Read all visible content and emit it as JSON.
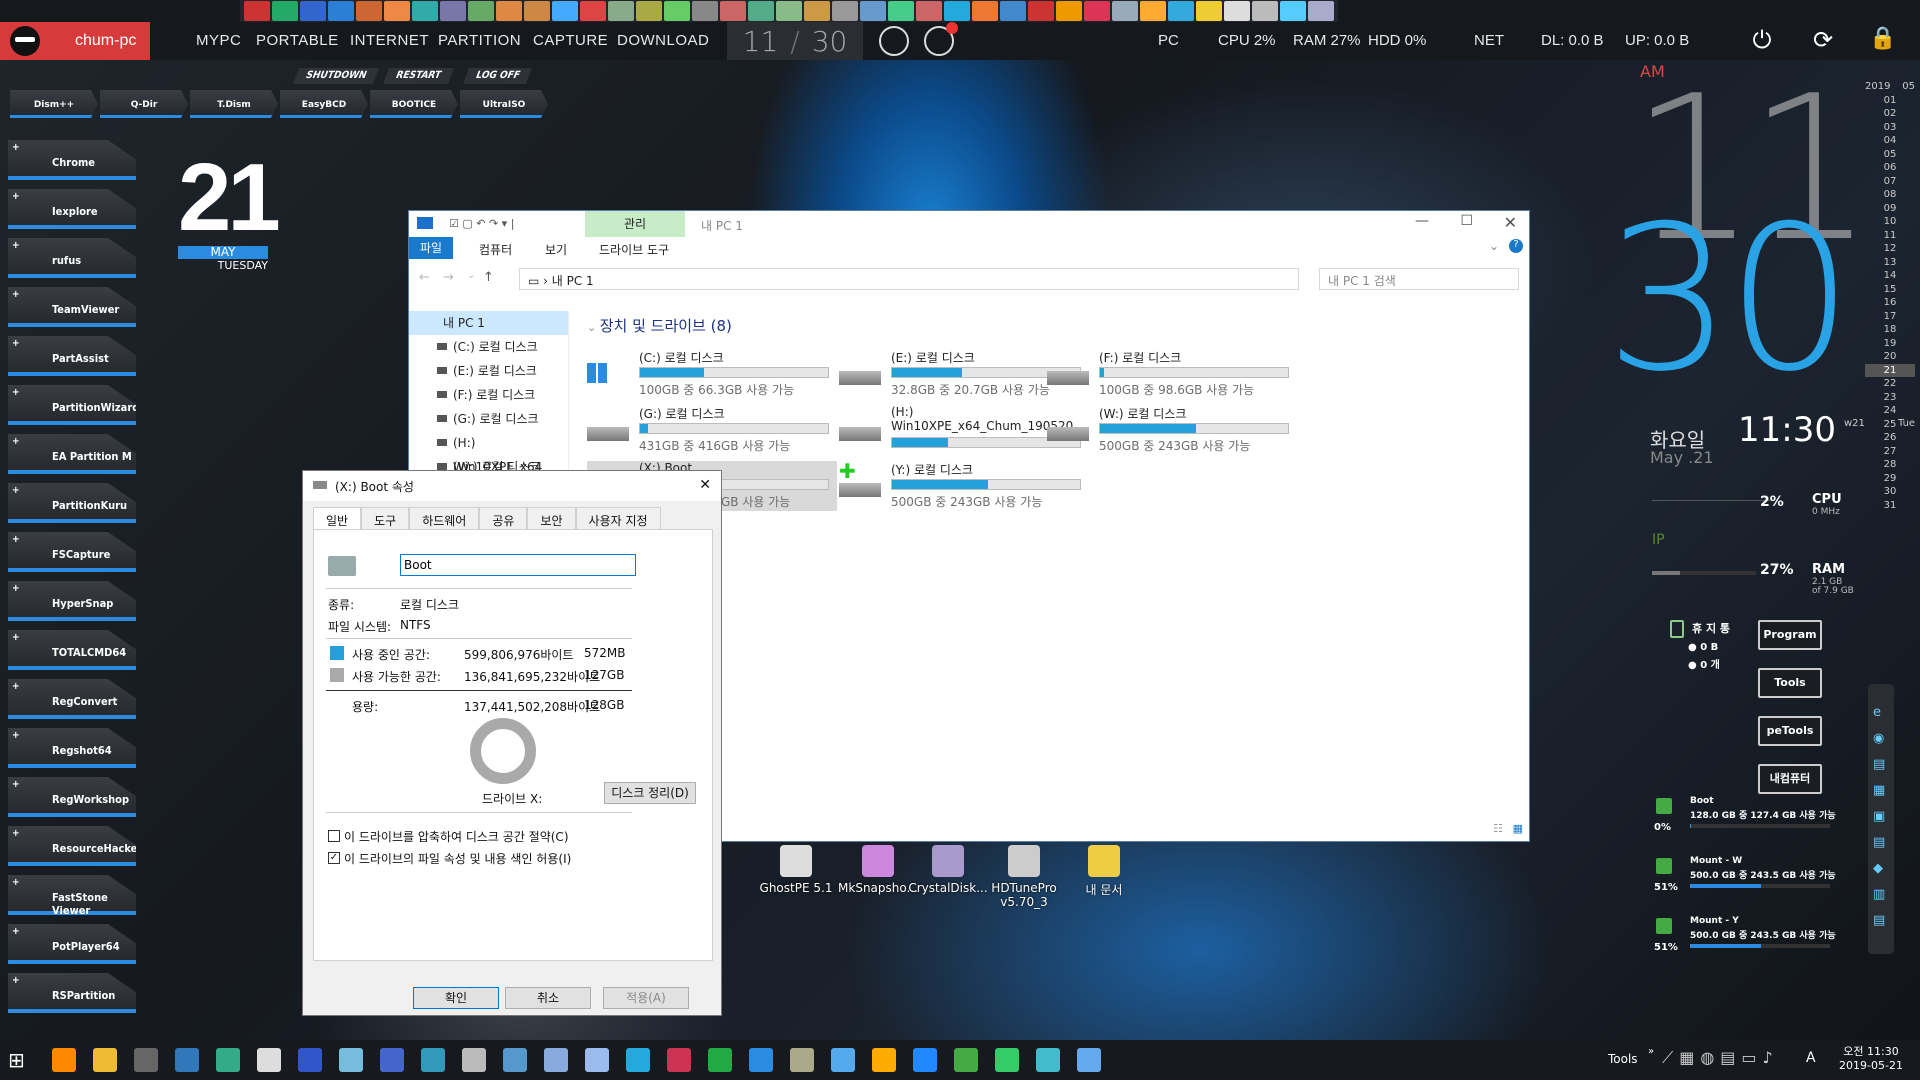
{
  "topbar": {
    "user": "chum-pc",
    "nav": [
      "MYPC",
      "PORTABLE",
      "INTERNET",
      "PARTITION",
      "CAPTURE",
      "DOWNLOAD"
    ],
    "clock_h": "11",
    "clock_m": "30",
    "pc": "PC",
    "cpu": "CPU  2%",
    "ram": "RAM  27%",
    "hdd": "HDD  0%",
    "net": "NET",
    "dl": "DL: 0.0 B",
    "up": "UP: 0.0 B"
  },
  "session": [
    "SHUTDOWN",
    "RESTART",
    "LOG OFF"
  ],
  "tools": [
    "Dism++",
    "Q-Dir",
    "T.Dism",
    "EasyBCD",
    "BOOTICE",
    "UltraISO"
  ],
  "launchers": [
    "Chrome",
    "Iexplore",
    "rufus",
    "TeamViewer",
    "PartAssist",
    "PartitionWizard",
    "EA Partition M",
    "PartitionKuru",
    "FSCapture",
    "HyperSnap",
    "TOTALCMD64",
    "RegConvert",
    "Regshot64",
    "RegWorkshop",
    "ResourceHacker",
    "FastStone Viewer",
    "PotPlayer64",
    "RSPartition"
  ],
  "datew": {
    "day": "21",
    "month": "MAY",
    "weekday": "TUESDAY"
  },
  "explorer": {
    "title": "내 PC 1",
    "manage_tab": "관리",
    "tabs": [
      "파일",
      "컴퓨터",
      "보기",
      "드라이브 도구"
    ],
    "address": "내 PC 1",
    "search": "내 PC 1 검색",
    "tree": [
      "내 PC 1",
      "(C:) 로컬 디스크",
      "(E:) 로컬 디스크",
      "(F:) 로컬 디스크",
      "(G:) 로컬 디스크",
      "(H:) Win10XPE_x64",
      "(W:) 로컬 디스크"
    ],
    "section": "장치 및 드라이브 (8)",
    "drives": [
      {
        "name": "(C:) 로컬 디스크",
        "size": "100GB 중 66.3GB 사용 가능",
        "used": 0.34
      },
      {
        "name": "(E:) 로컬 디스크",
        "size": "32.8GB 중 20.7GB 사용 가능",
        "used": 0.37
      },
      {
        "name": "(F:) 로컬 디스크",
        "size": "100GB 중 98.6GB 사용 가능",
        "used": 0.02
      },
      {
        "name": "(G:) 로컬 디스크",
        "size": "431GB 중 416GB 사용 가능",
        "used": 0.04
      },
      {
        "name": "(H:)",
        "name2": "Win10XPE_x64_Chum_190520",
        "used": 0.3
      },
      {
        "name": "(W:) 로컬 디스크",
        "size": "500GB 중 243GB 사용 가능",
        "used": 0.51
      },
      {
        "name": "(X:) Boot",
        "size": "128GB 중 127GB 사용 가능",
        "used": 0.01
      },
      {
        "name": "(Y:) 로컬 디스크",
        "size": "500GB 중 243GB 사용 가능",
        "used": 0.51
      }
    ]
  },
  "props": {
    "title": "(X:) Boot 속성",
    "tabs": [
      "일반",
      "도구",
      "하드웨어",
      "공유",
      "보안",
      "사용자 지정"
    ],
    "label": "Boot",
    "type_l": "종류:",
    "type_v": "로컬 디스크",
    "fs_l": "파일 시스템:",
    "fs_v": "NTFS",
    "used_l": "사용 중인 공간:",
    "used_b": "599,806,976바이트",
    "used_h": "572MB",
    "free_l": "사용 가능한 공간:",
    "free_b": "136,841,695,232바이트",
    "free_h": "127GB",
    "cap_l": "용량:",
    "cap_b": "137,441,502,208바이트",
    "cap_h": "128GB",
    "drive": "드라이브 X:",
    "cleanup": "디스크 정리(D)",
    "compress": "이 드라이브를 압축하여 디스크 공간 절약(C)",
    "index": "이 드라이브의 파일 속성 및 내용 색인 허용(I)",
    "ok": "확인",
    "cancel": "취소",
    "apply": "적용(A)"
  },
  "desktop": [
    {
      "label": "GhostPE 5.1"
    },
    {
      "label": "MkSnapsho..."
    },
    {
      "label": "CrystalDisk..."
    },
    {
      "label": "HDTunePro",
      "label2": "v5.70_3"
    },
    {
      "label": "내 문서"
    }
  ],
  "rightclock": {
    "ampm": "AM",
    "h": "11",
    "m": "30",
    "weekday": "화요일",
    "date": "May .21",
    "time": "11:30",
    "cpu_pct": "2%",
    "cpu": "CPU",
    "cpu_mhz": "0 MHz",
    "ip": "IP",
    "ram_pct": "27%",
    "ram": "RAM",
    "ram_sub": "2.1 GB",
    "ram_sub2": "of 7.9 GB"
  },
  "calendar": {
    "year": "2019",
    "month": "05",
    "days": [
      "01",
      "02",
      "03",
      "04",
      "05",
      "06",
      "07",
      "08",
      "09",
      "10",
      "11",
      "12",
      "13",
      "14",
      "15",
      "16",
      "17",
      "18",
      "19",
      "20",
      "21",
      "22",
      "23",
      "24",
      "25",
      "26",
      "27",
      "28",
      "29",
      "30",
      "31"
    ],
    "week": "w21",
    "today_dow": "Tue"
  },
  "recycle": {
    "title": "휴 지 통",
    "size": "0 B",
    "count": "0 개"
  },
  "rbuttons": [
    "Program",
    "Tools",
    "peTools",
    "내컴퓨터"
  ],
  "disks": [
    {
      "pct": "0%",
      "name": "Boot",
      "info": "128.0 GB 중 127.4 GB 사용 가능",
      "used": 0.01
    },
    {
      "pct": "51%",
      "name": "Mount - W",
      "info": "500.0 GB 중 243.5 GB 사용 가능",
      "used": 0.51
    },
    {
      "pct": "51%",
      "name": "Mount - Y",
      "info": "500.0 GB 중 243.5 GB 사용 가능",
      "used": 0.51
    }
  ],
  "tray": {
    "tools": "Tools",
    "ime": "A",
    "time": "오전 11:30",
    "date": "2019-05-21"
  }
}
